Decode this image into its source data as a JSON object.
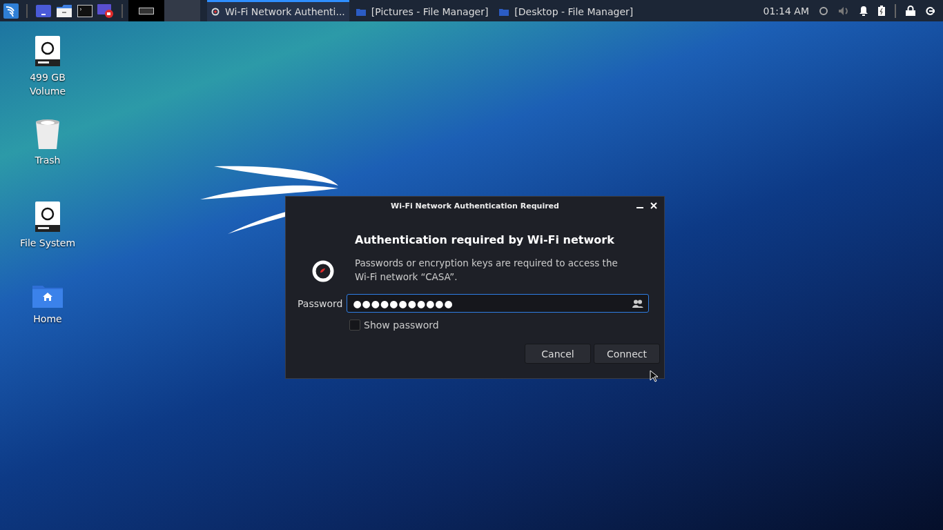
{
  "panel": {
    "launchers": [
      {
        "kind": "files"
      },
      {
        "kind": "folder"
      },
      {
        "kind": "terminal"
      },
      {
        "kind": "recorder"
      }
    ],
    "workspaces": [
      {
        "selected": true
      },
      {
        "selected": false
      }
    ],
    "tasks": [
      {
        "label": "Wi-Fi Network Authenti...",
        "kind": "network",
        "selected": true
      },
      {
        "label": "[Pictures - File Manager]",
        "kind": "folder",
        "selected": false
      },
      {
        "label": "[Desktop - File Manager]",
        "kind": "folder",
        "selected": false
      }
    ],
    "clock": "01:14 AM"
  },
  "desktop_icons": [
    {
      "label": "499 GB\nVolume",
      "kind": "drive"
    },
    {
      "label": "Trash",
      "kind": "trash"
    },
    {
      "label": "File System",
      "kind": "drive"
    },
    {
      "label": "Home",
      "kind": "home"
    }
  ],
  "dialog": {
    "title": "Wi-Fi Network Authentication Required",
    "heading": "Authentication required by Wi-Fi network",
    "message": "Passwords or encryption keys are required to access the Wi-Fi network “CASA”.",
    "password_label": "Password",
    "password_value": "●●●●●●●●●●●",
    "show_password": {
      "label": "Show password",
      "checked": false
    },
    "buttons": [
      "Cancel",
      "Connect"
    ]
  }
}
